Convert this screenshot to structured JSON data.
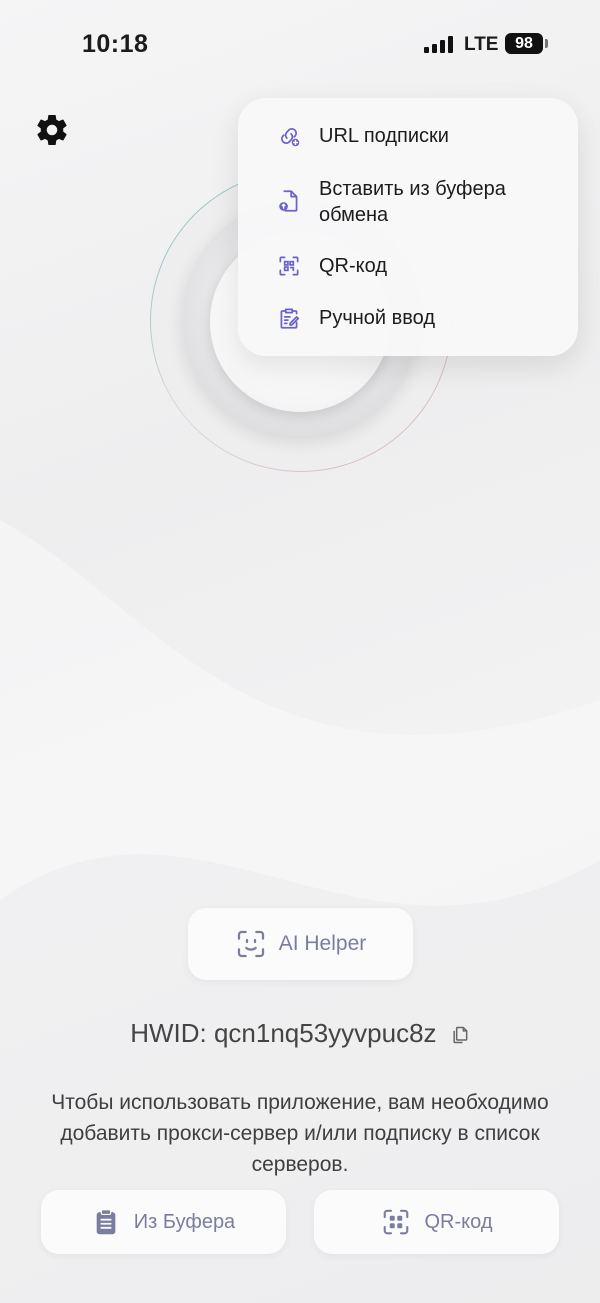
{
  "status_bar": {
    "time": "10:18",
    "network": "LTE",
    "battery": "98"
  },
  "menu": {
    "items": [
      {
        "label": "URL подписки",
        "icon": "link-plus-icon"
      },
      {
        "label": "Вставить из буфера обмена",
        "icon": "file-upload-icon"
      },
      {
        "label": "QR-код",
        "icon": "qr-scan-icon"
      },
      {
        "label": "Ручной ввод",
        "icon": "clipboard-edit-icon"
      }
    ]
  },
  "ai_helper": {
    "label": "AI Helper"
  },
  "hwid": {
    "text": "HWID: qcn1nq53yyvpuc8z"
  },
  "info": {
    "text": "Чтобы использовать приложение, вам необходимо добавить прокси-сервер и/или подписку в список серверов."
  },
  "buttons": {
    "from_buffer": "Из Буфера",
    "qr": "QR-код"
  },
  "colors": {
    "accent": "#6b63c9",
    "button_text": "#7a7e9e"
  }
}
